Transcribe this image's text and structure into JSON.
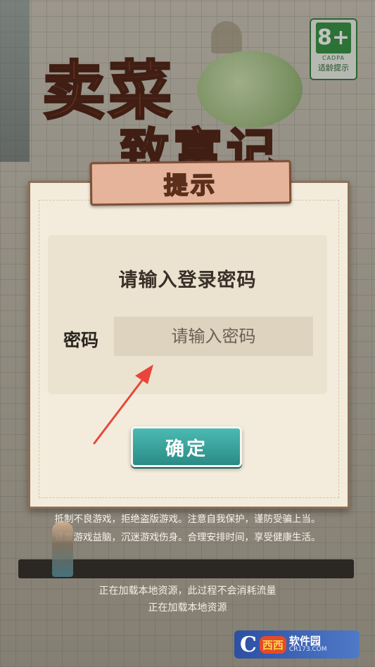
{
  "rating": {
    "age": "8+",
    "org": "CADPA",
    "tip": "适龄提示"
  },
  "logo": {
    "title": "卖菜",
    "subtitle": "致富记"
  },
  "dialog": {
    "title": "提示",
    "prompt": "请输入登录密码",
    "password_label": "密码",
    "password_value": "",
    "password_placeholder": "请输入密码",
    "confirm_label": "确定"
  },
  "notice": {
    "line1": "抵制不良游戏，拒绝盗版游戏。注意自我保护，谨防受骗上当。",
    "line2": "适度游戏益脑，沉迷游戏伤身。合理安排时间，享受健康生活。"
  },
  "loading": {
    "progress": 0,
    "line1": "正在加载本地资源，此过程不会消耗流量",
    "line2": "正在加载本地资源"
  },
  "watermark": {
    "mark": "C",
    "xx": "西西",
    "name": "软件园",
    "domain": "CR173.COM"
  }
}
